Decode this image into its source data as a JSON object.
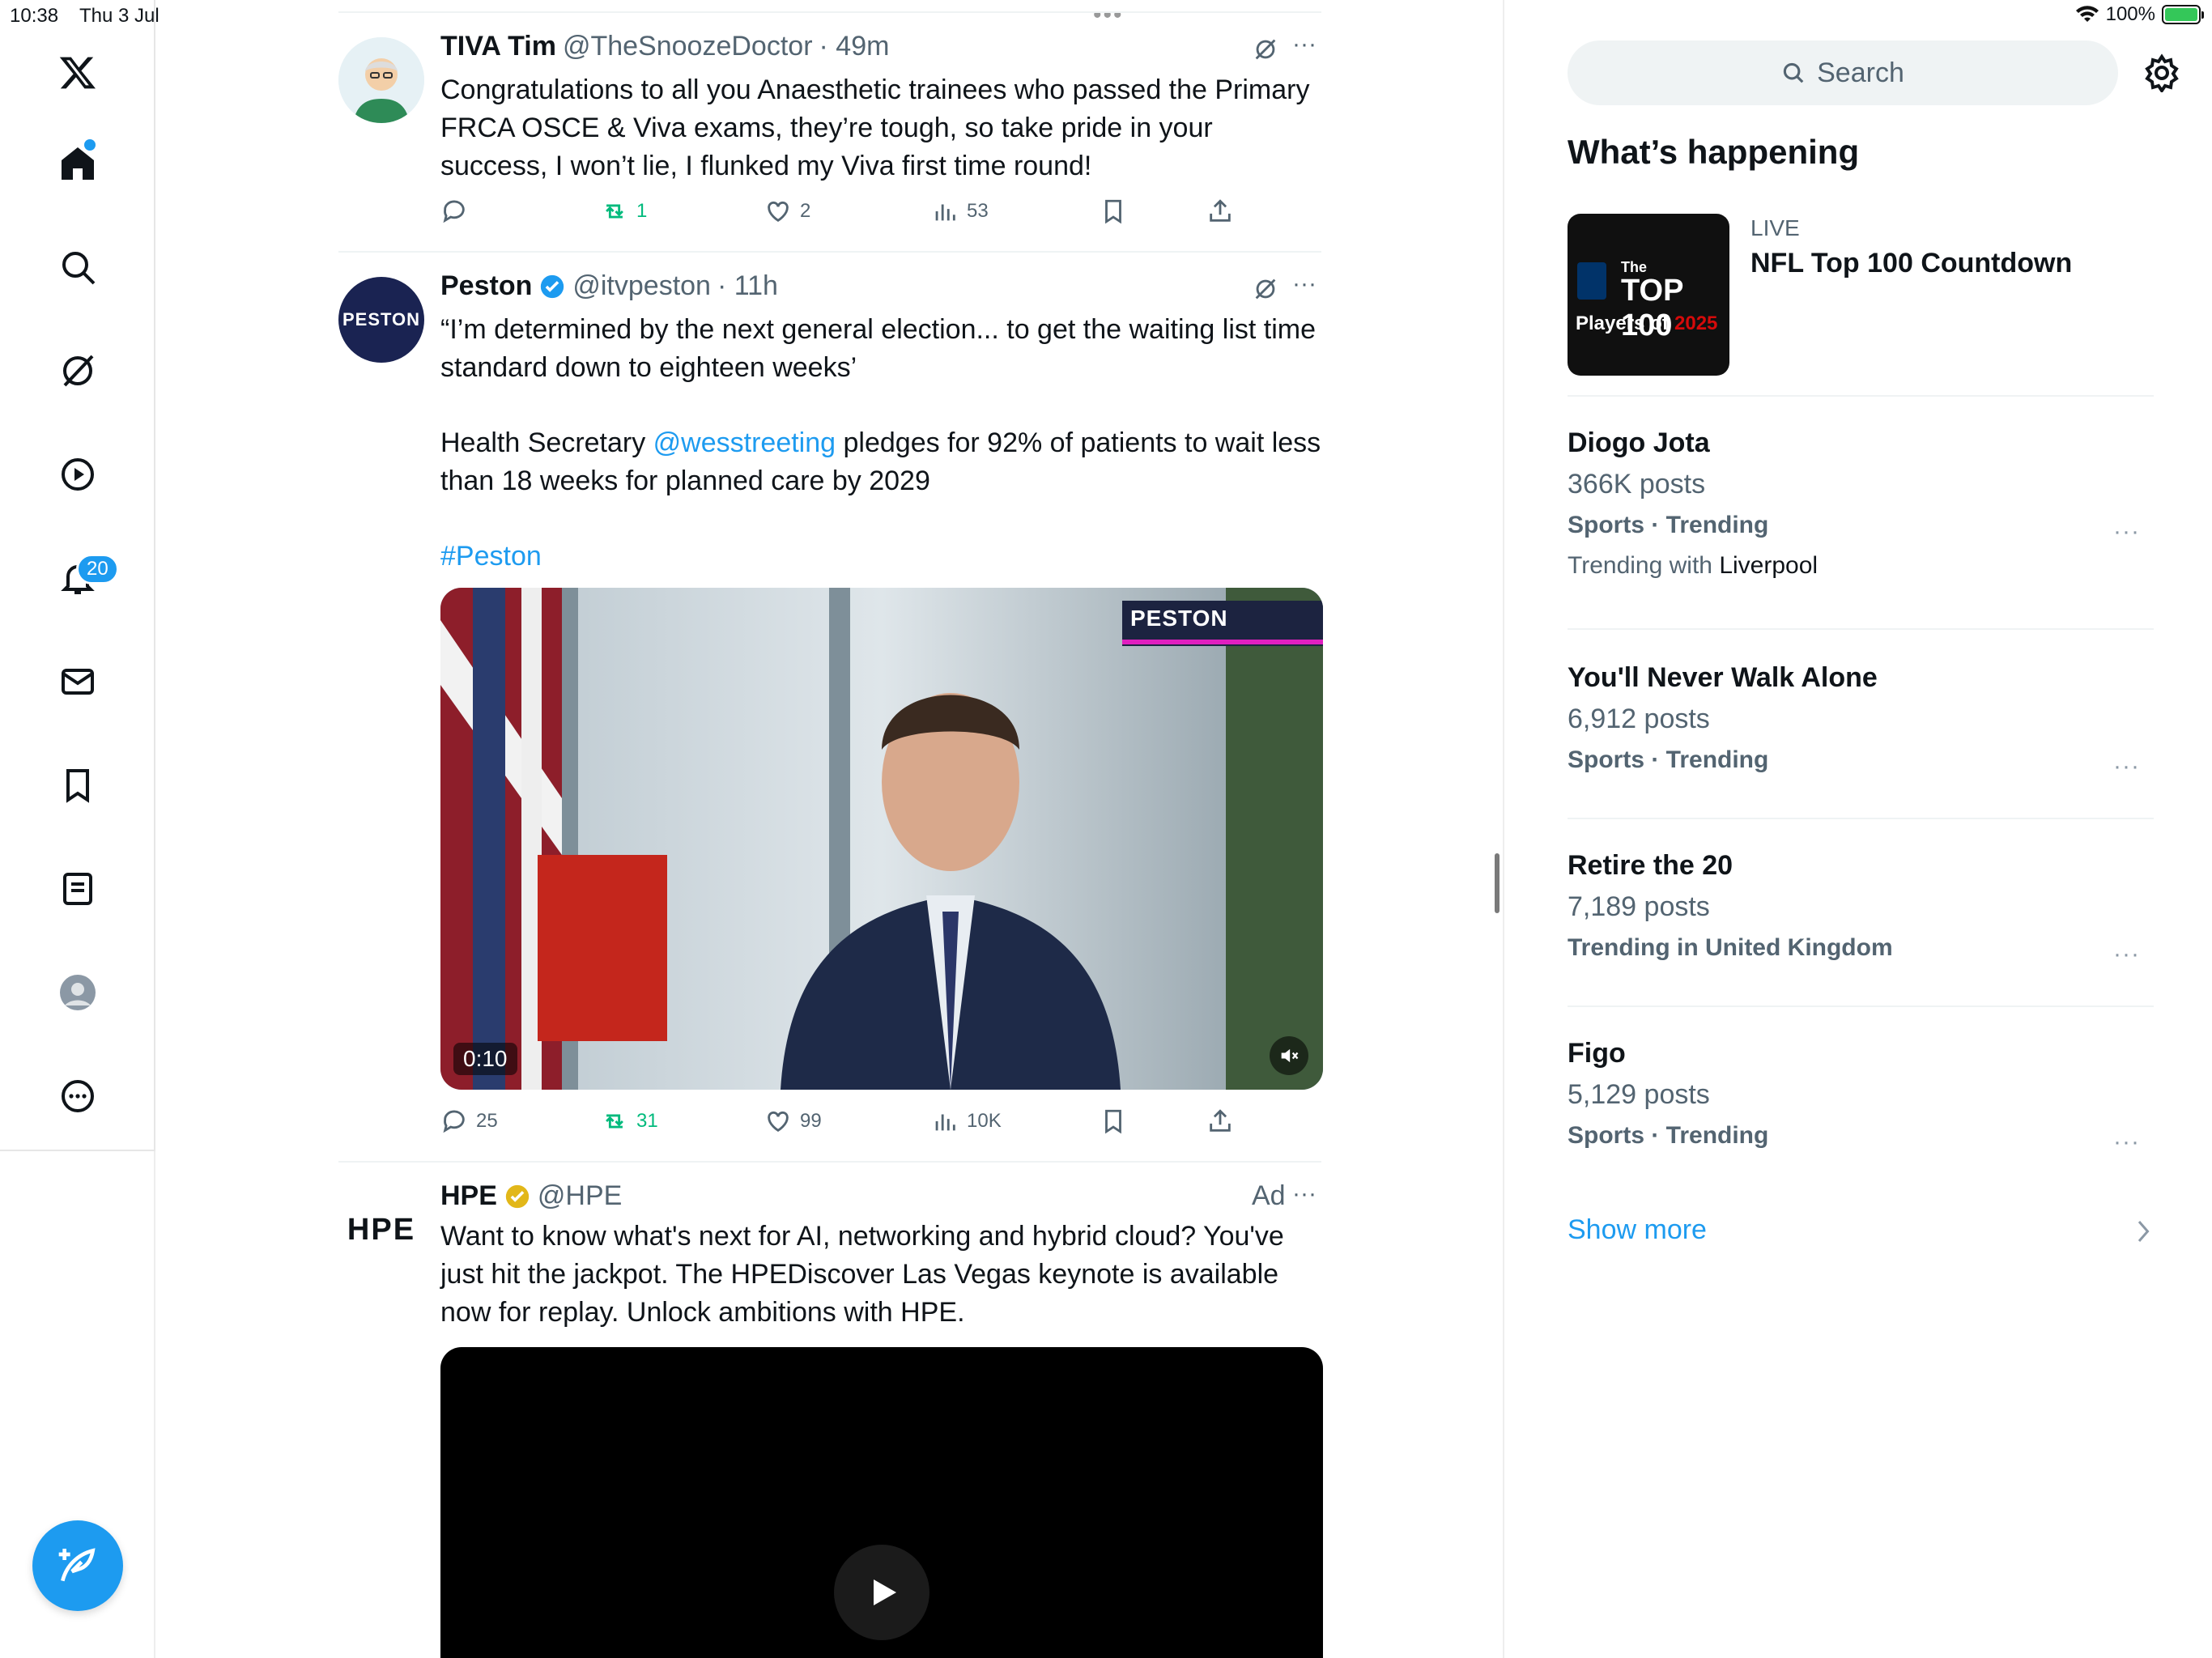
{
  "status_bar": {
    "time": "10:38",
    "date": "Thu 3 Jul",
    "battery": "100%",
    "battery_level": 1.0
  },
  "nav": {
    "items": [
      "Home",
      "Explore",
      "Grok",
      "Video",
      "Notifications",
      "Messages",
      "Bookmarks",
      "Lists",
      "Profile",
      "More"
    ],
    "notifications_badge": "20"
  },
  "handle_dots": "•••",
  "tweets": [
    {
      "name": "TIVA Tim",
      "handle": "@TheSnoozeDoctor",
      "time": "· 49m",
      "text": "Congratulations to all you Anaesthetic trainees who passed the Primary FRCA OSCE & Viva exams, they’re tough, so take pride in your success, I won’t lie, I flunked my Viva first time round!",
      "replies": "",
      "retweets": "1",
      "likes": "2",
      "views": "53"
    },
    {
      "name": "Peston",
      "handle": "@itvpeston",
      "time": "· 11h",
      "text_line1": "“I’m determined by the next general election... to get the waiting list time standard down to eighteen weeks’",
      "text_line2_pre": "Health Secretary ",
      "text_line2_mention": "@wesstreeting",
      "text_line2_post": " pledges for 92% of patients to wait less than 18 weeks for planned care by 2029",
      "hashtag": "#Peston",
      "video_logo": "PESTON",
      "video_time": "0:10",
      "replies": "25",
      "retweets": "31",
      "likes": "99",
      "views": "10K"
    },
    {
      "name": "HPE",
      "handle": "@HPE",
      "ad_label": "Ad",
      "logo": "HPE",
      "text": "Want to know what's next for AI, networking and hybrid cloud? You've just hit the jackpot. The HPEDiscover Las Vegas keynote is available now for replay. Unlock ambitions with HPE."
    }
  ],
  "sidebar": {
    "search_placeholder": "Search",
    "title": "What’s happening",
    "live": {
      "tag": "LIVE",
      "title": "NFL Top 100 Countdown",
      "thumb_lines": [
        "The",
        "TOP 100",
        "Players of",
        "2025"
      ]
    },
    "trends": [
      {
        "title": "Diogo Jota",
        "count": "366K posts",
        "category": "Sports · Trending",
        "with_label": "Trending with ",
        "with_value": "Liverpool"
      },
      {
        "title": "You'll Never Walk Alone",
        "count": "6,912 posts",
        "category": "Sports · Trending"
      },
      {
        "title": "Retire the 20",
        "count": "7,189 posts",
        "category": "Trending in United Kingdom"
      },
      {
        "title": "Figo",
        "count": "5,129 posts",
        "category": "Sports · Trending"
      }
    ],
    "show_more": "Show more"
  },
  "colors": {
    "accent": "#1d9bf0",
    "retweet": "#00ba7c",
    "muted": "#536471"
  }
}
